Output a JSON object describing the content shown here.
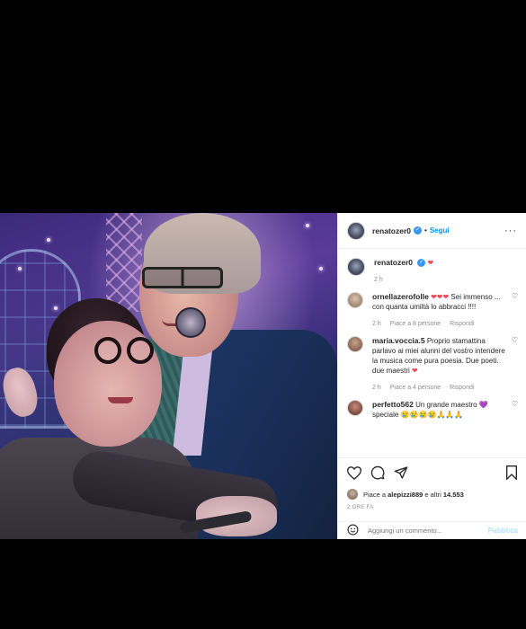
{
  "post": {
    "username": "renatozer0",
    "separator": "•",
    "follow_label": "Segui",
    "more_label": "···",
    "caption_emoji": "❤",
    "caption_time": "2 h"
  },
  "comments": [
    {
      "username": "ornellazerofolle",
      "hearts": "❤❤❤",
      "text": "Sei immenso ... con quanta umiltà lo abbracci !!!!",
      "time": "2 h",
      "likes": "Piace a 8 persone",
      "reply_label": "Rispondi"
    },
    {
      "username": "maria.voccia.5",
      "text": "Proprio stamattina parlavo ai miei alunni del vostro intendere la musica come pura poesia. Due poeti. due maestri",
      "heart": "❤",
      "time": "2 h",
      "likes": "Piace a 4 persone",
      "reply_label": "Rispondi"
    },
    {
      "username": "perfetto562",
      "text": "Un grande maestro",
      "heart_purple": "💜",
      "text2": "speciale",
      "emojis": "😢😢😢😢🙏🙏🙏",
      "time": "",
      "likes": "",
      "reply_label": ""
    }
  ],
  "likes": {
    "prefix": "Piace a",
    "user": "alepizzi889",
    "suffix": "e altri",
    "count": "14.553"
  },
  "timestamp": "2 ORE FA",
  "add_comment": {
    "placeholder": "Aggiungi un commento...",
    "publish_label": "Pubblica"
  },
  "icons": [
    "heart-icon",
    "comment-icon",
    "share-icon",
    "bookmark-icon",
    "emoji-icon"
  ]
}
